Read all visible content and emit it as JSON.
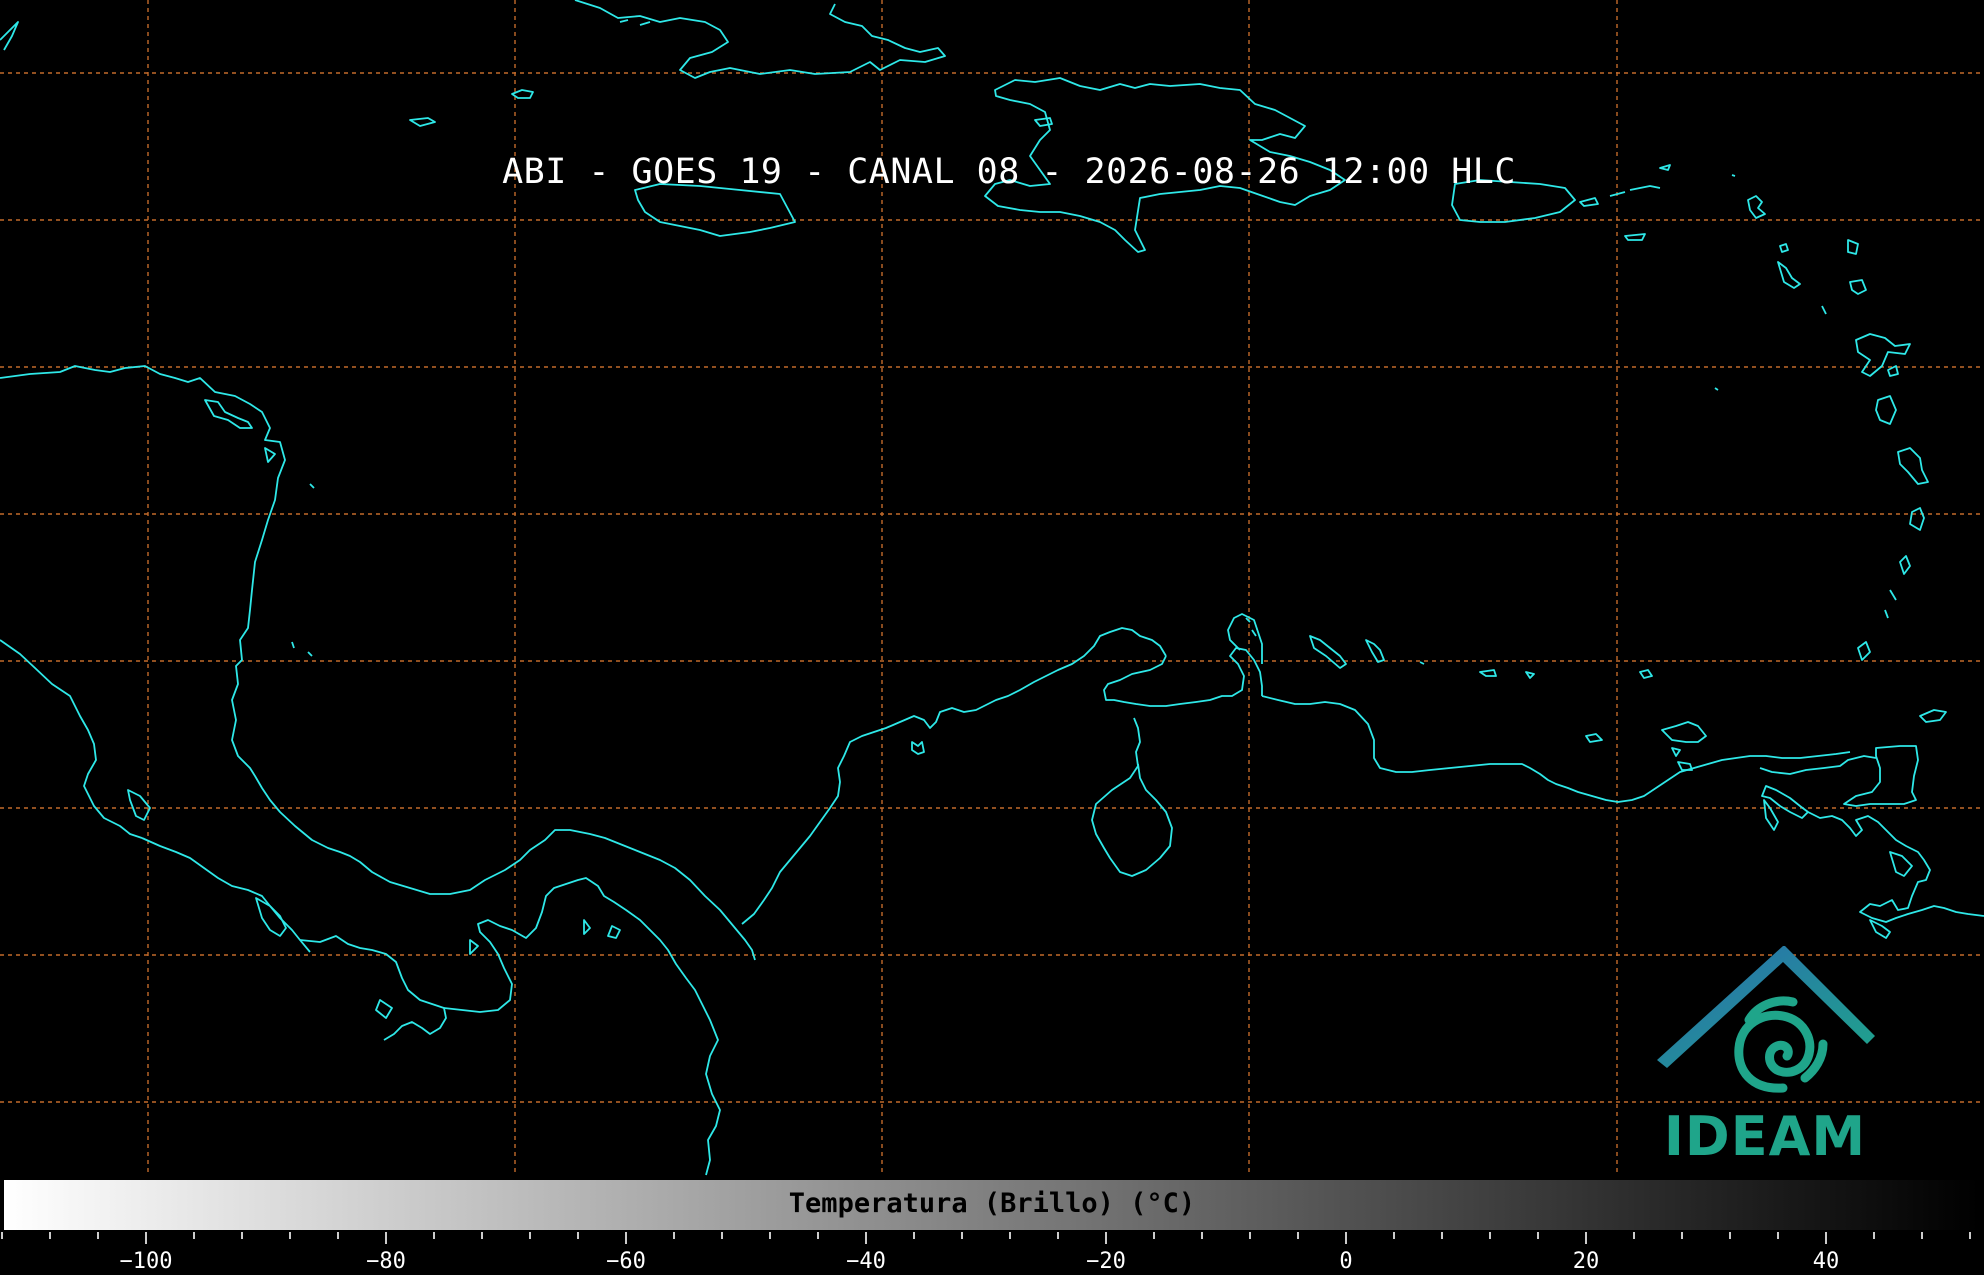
{
  "title": "ABI - GOES 19 - CANAL 08 - 2026-08-26 12:00 HLC",
  "product": {
    "instrument": "ABI",
    "satellite": "GOES 19",
    "channel": "CANAL 08",
    "datetime": "2026-08-26 12:00 HLC"
  },
  "logo": {
    "text": "IDEAM"
  },
  "colorbar": {
    "label": "Temperatura (Brillo) (°C)",
    "range_c": [
      -112,
      53
    ],
    "gradient": [
      "#ffffff",
      "#000000"
    ],
    "major_ticks": [
      "−100",
      "−80",
      "−60",
      "−40",
      "−20",
      "0",
      "20",
      "40"
    ],
    "major_tick_values": [
      -100,
      -80,
      -60,
      -40,
      -20,
      0,
      20,
      40
    ],
    "minor_step_c": 4
  },
  "colors": {
    "background": "#000000",
    "coastline": "#2ee8e8",
    "graticule": "#c26a2a",
    "logo_primary": "#1fa58a",
    "logo_secondary": "#2a6bb0"
  }
}
